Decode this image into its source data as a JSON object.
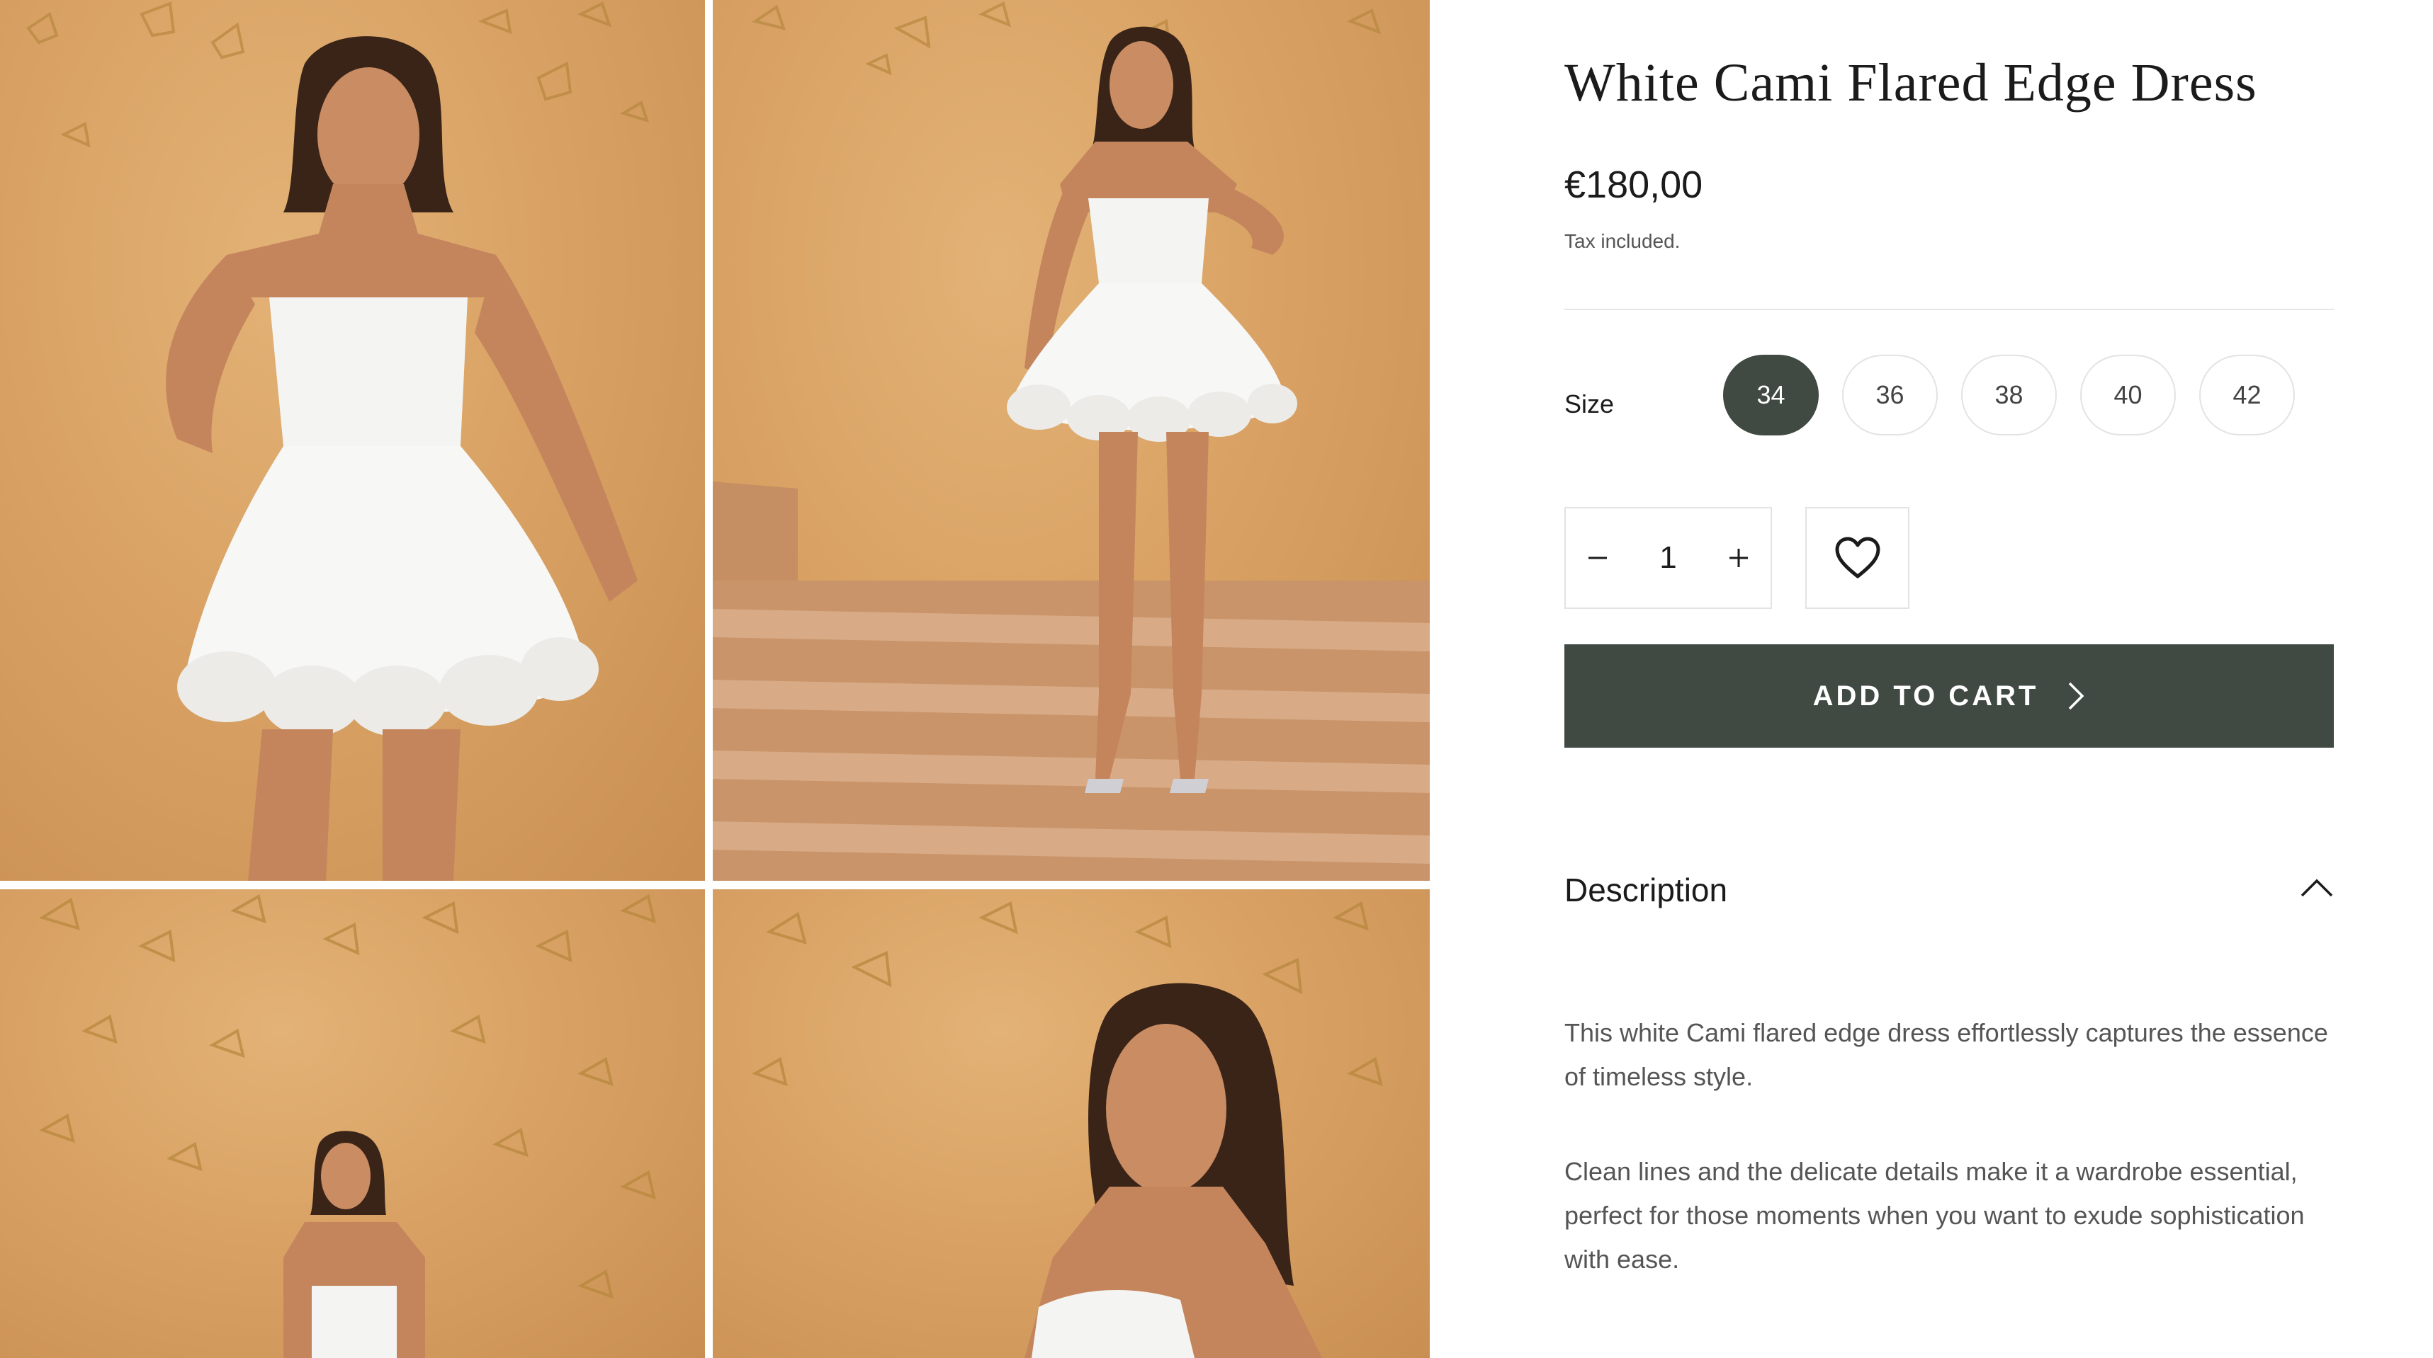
{
  "gallery": {
    "images": [
      {
        "alt": "model-wearing-white-dress-front"
      },
      {
        "alt": "model-standing-on-steps"
      },
      {
        "alt": "model-with-butterflies-wall"
      },
      {
        "alt": "model-profile-closeup"
      }
    ]
  },
  "product": {
    "title": "White Cami Flared Edge Dress",
    "price": "€180,00",
    "tax_note": "Tax included.",
    "size_label": "Size",
    "sizes": [
      "34",
      "36",
      "38",
      "40",
      "42"
    ],
    "selected_size": "34",
    "quantity": "1",
    "decrease_symbol": "−",
    "increase_symbol": "+",
    "add_to_cart_label": "ADD TO CART",
    "description_title": "Description",
    "description_paragraphs": [
      "This white Cami flared edge dress effortlessly captures the essence of timeless style.",
      "Clean lines and the delicate details make it a wardrobe essential, perfect for those moments when you want to exude sophistication with ease."
    ]
  },
  "colors": {
    "accent": "#404942",
    "photo_background": "#d9a264",
    "border": "#e3e3e3"
  },
  "icons": {
    "decrease": "minus-icon",
    "increase": "plus-icon",
    "wishlist": "heart-icon",
    "cart_arrow": "chevron-right-icon",
    "description_toggle": "chevron-up-icon"
  }
}
